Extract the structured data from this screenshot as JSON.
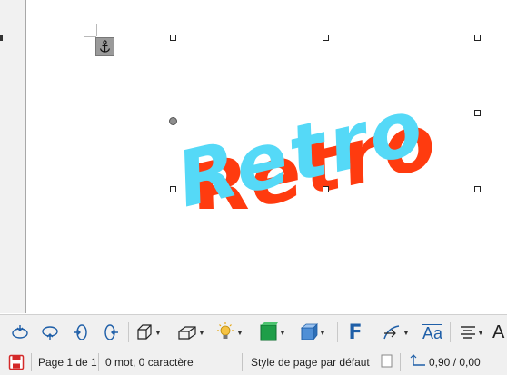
{
  "document": {
    "fontwork_text": "Retro",
    "front_color": "#55d9f7",
    "shadow_color": "#ff3b0f"
  },
  "toolbar": {
    "icons": [
      "tilt-down-icon",
      "tilt-up-icon",
      "tilt-left-icon",
      "tilt-right-icon",
      "depth-icon",
      "direction-icon",
      "lighting-icon",
      "surface-icon",
      "3d-color-icon",
      "fontwork-shape-icon",
      "fontwork-alignment-icon",
      "fontwork-same-letter-heights-icon",
      "align-text-icon",
      "character-spacing-icon"
    ],
    "fontwork_label": "F",
    "same_height_label": "Aa",
    "spacing_label": "A"
  },
  "status": {
    "page": "Page 1 de 1",
    "words": "0 mot, 0 caractère",
    "page_style": "Style de page par défaut",
    "position": "0,90 / 0,00"
  }
}
